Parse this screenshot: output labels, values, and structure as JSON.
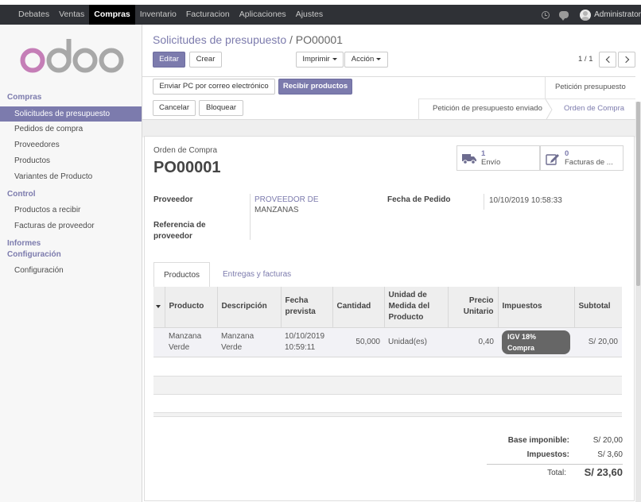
{
  "navbar": {
    "menus": [
      "Debates",
      "Ventas",
      "Compras",
      "Inventario",
      "Facturacion",
      "Aplicaciones",
      "Ajustes"
    ],
    "active_menu": "Compras",
    "user": "Administrator"
  },
  "sidebar": {
    "sections": [
      {
        "header": "Compras",
        "items": [
          "Solicitudes de presupuesto",
          "Pedidos de compra",
          "Proveedores",
          "Productos",
          "Variantes de Producto"
        ]
      },
      {
        "header": "Control",
        "items": [
          "Productos a recibir",
          "Facturas de proveedor"
        ]
      },
      {
        "header": "Informes",
        "items": []
      },
      {
        "header": "Configuración",
        "items": [
          "Configuración"
        ]
      }
    ],
    "active_item": "Solicitudes de presupuesto"
  },
  "breadcrumb": {
    "parent": "Solicitudes de presupuesto",
    "separator": "/",
    "current": "PO00001"
  },
  "controls": {
    "edit": "Editar",
    "create": "Crear",
    "print": "Imprimir",
    "action": "Acción",
    "pager": "1 / 1"
  },
  "status_buttons": {
    "send_email": "Enviar PC por correo electrónico",
    "receive": "Recibir productos",
    "cancel": "Cancelar",
    "lock": "Bloquear"
  },
  "stages": {
    "top": "Petición presupuesto",
    "sent": "Petición de presupuesto enviado",
    "current": "Orden de Compra"
  },
  "document": {
    "label": "Orden de Compra",
    "name": "PO00001"
  },
  "smart_buttons": [
    {
      "count": "1",
      "label": "Envío",
      "icon": "truck-icon"
    },
    {
      "count": "0",
      "label": "Facturas de ...",
      "icon": "edit-icon"
    }
  ],
  "fields": {
    "vendor_label": "Proveedor",
    "vendor_value_line1": "PROVEEDOR DE",
    "vendor_value_line2": "MANZANAS",
    "vendor_ref_label_line1": "Referencia de",
    "vendor_ref_label_line2": "proveedor",
    "order_date_label": "Fecha de Pedido",
    "order_date_value": "10/10/2019 10:58:33"
  },
  "tabs": [
    "Productos",
    "Entregas y facturas"
  ],
  "table": {
    "headers": [
      "Producto",
      "Descripción",
      "Fecha prevista",
      "Cantidad",
      "Unidad de Medida del Producto",
      "Precio Unitario",
      "Impuestos",
      "Subtotal"
    ],
    "rows": [
      {
        "product": "Manzana Verde",
        "description": "Manzana Verde",
        "date": "10/10/2019 10:59:11",
        "qty": "50,000",
        "uom": "Unidad(es)",
        "price": "0,40",
        "tax": "IGV 18% Compra",
        "subtotal": "S/ 20,00"
      }
    ]
  },
  "totals": {
    "untaxed_label": "Base imponible:",
    "untaxed_value": "S/ 20,00",
    "taxes_label": "Impuestos:",
    "taxes_value": "S/ 3,60",
    "total_label": "Total:",
    "total_value": "S/ 23,60"
  },
  "colors": {
    "brand": "#7c7bad",
    "navbar": "#2f3136",
    "badge": "#666666"
  }
}
